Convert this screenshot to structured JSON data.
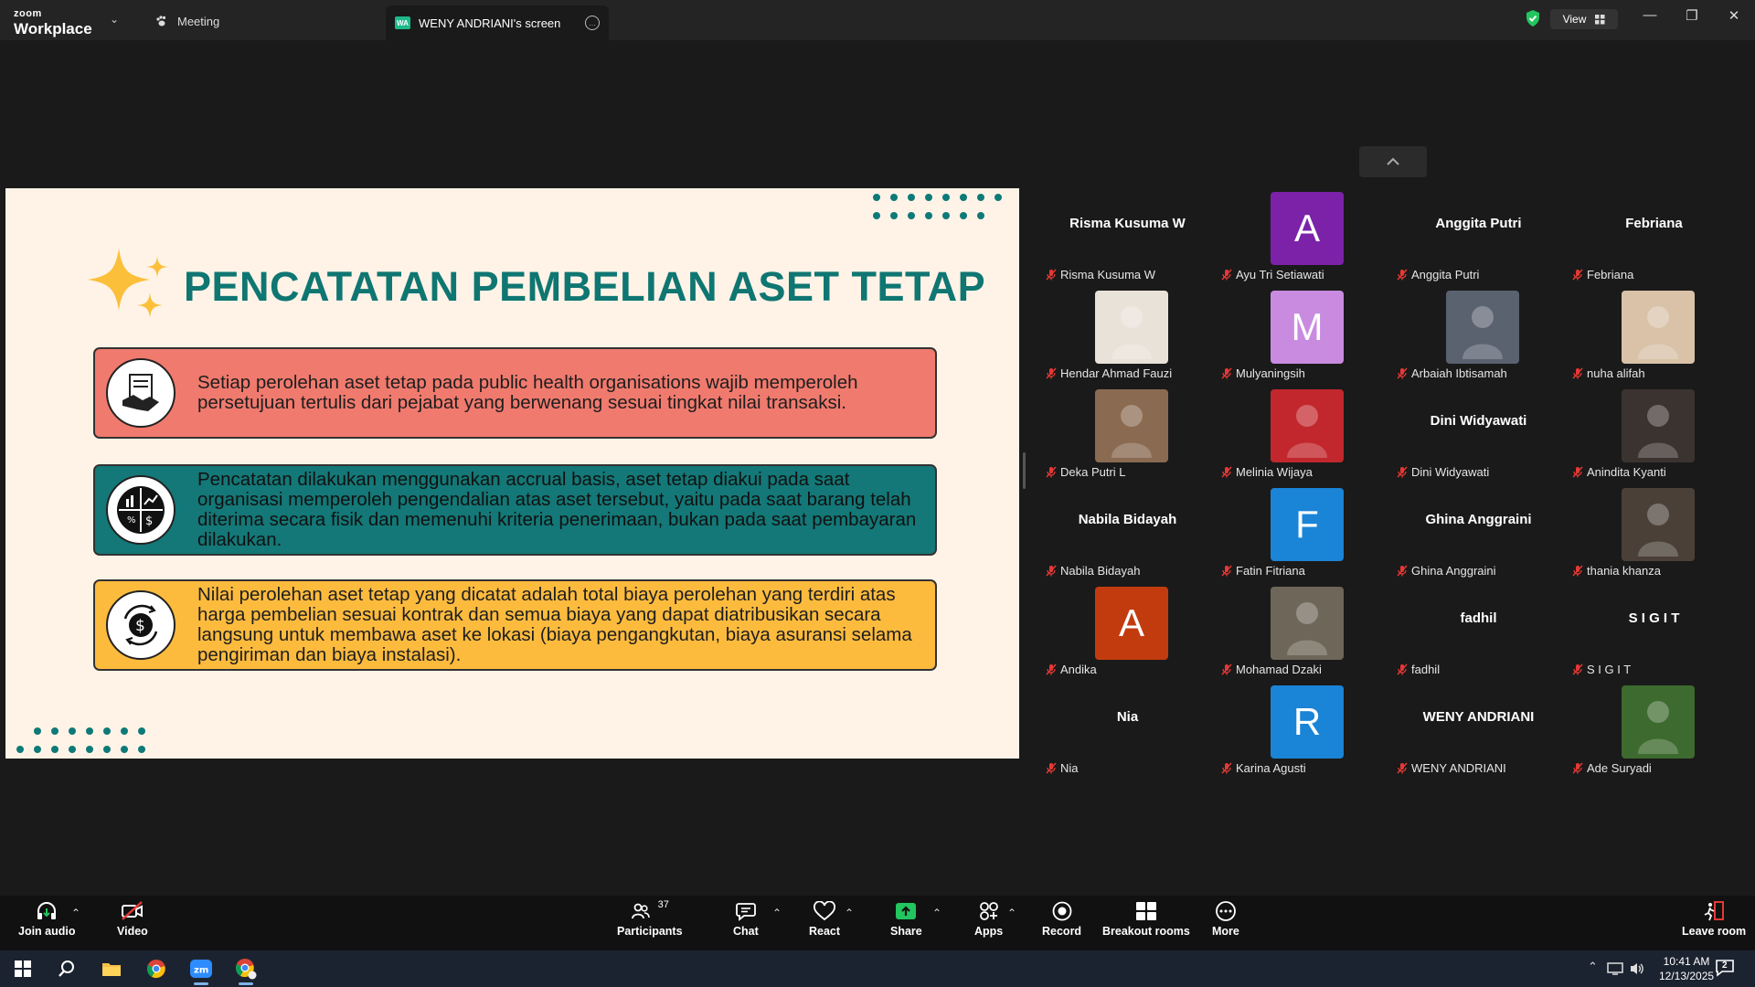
{
  "app": {
    "brand_top": "zoom",
    "brand_main": "Workplace"
  },
  "tabs": {
    "meeting": "Meeting",
    "screen_badge": "WA",
    "screen": "WENY ANDRIANI's screen"
  },
  "view_label": "View",
  "slide": {
    "title": "PENCATATAN PEMBELIAN ASET TETAP",
    "box1": "Setiap perolehan aset tetap pada public health organisations wajib memperoleh persetujuan tertulis dari pejabat yang berwenang sesuai tingkat nilai transaksi.",
    "box2": "Pencatatan dilakukan menggunakan accrual basis, aset tetap diakui pada saat organisasi memperoleh pengendalian atas aset tersebut, yaitu pada saat barang telah diterima secara fisik dan memenuhi kriteria penerimaan, bukan pada saat pembayaran dilakukan.",
    "box3": "Nilai perolehan aset tetap yang dicatat adalah total biaya perolehan yang terdiri atas harga pembelian sesuai kontrak dan semua biaya yang dapat diatribusikan secara langsung untuk membawa aset ke lokasi (biaya pengangkutan, biaya asuransi selama pengiriman dan biaya instalasi)."
  },
  "participants": [
    {
      "name": "Risma Kusuma W",
      "big": "Risma Kusuma W"
    },
    {
      "name": "Ayu Tri Setiawati",
      "letter": "A",
      "color": "#7b22a8"
    },
    {
      "name": "Anggita Putri",
      "big": "Anggita Putri"
    },
    {
      "name": "Febriana",
      "big": "Febriana"
    },
    {
      "name": "Hendar Ahmad Fauzi",
      "photo": "#e8e2d8"
    },
    {
      "name": "Mulyaningsih",
      "letter": "M",
      "color": "#c98be0"
    },
    {
      "name": "Arbaiah Ibtisamah",
      "photo": "#5a6270"
    },
    {
      "name": "nuha alifah",
      "photo": "#d9c2a8"
    },
    {
      "name": "Deka Putri L",
      "photo": "#8a6a50"
    },
    {
      "name": "Melinia Wijaya",
      "photo": "#c2272d"
    },
    {
      "name": "Dini Widyawati",
      "big": "Dini Widyawati"
    },
    {
      "name": "Anindita Kyanti",
      "photo": "#3b3330"
    },
    {
      "name": "Nabila Bidayah",
      "big": "Nabila Bidayah"
    },
    {
      "name": "Fatin Fitriana",
      "letter": "F",
      "color": "#1a84d6"
    },
    {
      "name": "Ghina Anggraini",
      "big": "Ghina Anggraini"
    },
    {
      "name": "thania khanza",
      "photo": "#4a4038"
    },
    {
      "name": "Andika",
      "letter": "A",
      "color": "#c23b0e"
    },
    {
      "name": "Mohamad Dzaki",
      "photo": "#6e6658"
    },
    {
      "name": "fadhil",
      "big": "fadhil"
    },
    {
      "name": "S I G I T",
      "big": "S I G I T"
    },
    {
      "name": "Nia",
      "big": "Nia"
    },
    {
      "name": "Karina Agusti",
      "letter": "R",
      "color": "#1a84d6"
    },
    {
      "name": "WENY ANDRIANI",
      "big": "WENY ANDRIANI"
    },
    {
      "name": "Ade Suryadi",
      "photo": "#3d6a2e"
    }
  ],
  "toolbar": {
    "join_audio": "Join audio",
    "video": "Video",
    "participants": "Participants",
    "participants_count": "37",
    "chat": "Chat",
    "react": "React",
    "share": "Share",
    "apps": "Apps",
    "record": "Record",
    "breakout": "Breakout rooms",
    "more": "More",
    "leave": "Leave room"
  },
  "taskbar": {
    "time": "10:41 AM",
    "date": "12/13/2025",
    "notif_count": "2"
  },
  "colors": {
    "teal": "#0f7672",
    "salmon": "#f07a6e",
    "gold": "#fdbb3e",
    "share_green": "#22c55e"
  }
}
